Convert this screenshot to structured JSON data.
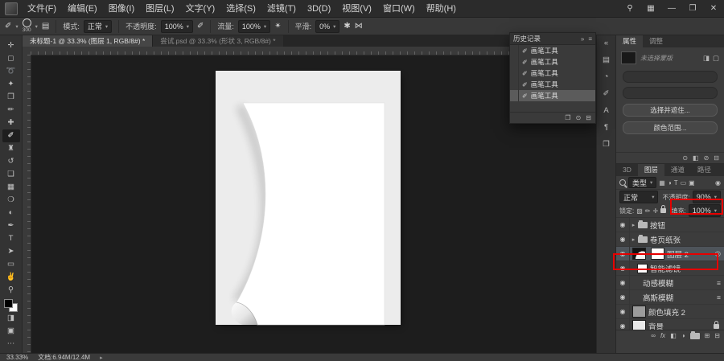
{
  "colors": {
    "accent-red": "#e60000",
    "canvas-bg": "#1d1d1d",
    "panel-bg": "#3c3c3c"
  },
  "menubar": {
    "items": [
      "文件(F)",
      "编辑(E)",
      "图像(I)",
      "图层(L)",
      "文字(Y)",
      "选择(S)",
      "滤镜(T)",
      "3D(D)",
      "视图(V)",
      "窗口(W)",
      "帮助(H)"
    ]
  },
  "optionsbar": {
    "brush_size": "300",
    "mode_label": "模式:",
    "mode_value": "正常",
    "opacity_label": "不透明度:",
    "opacity_value": "100%",
    "flow_label": "流量:",
    "flow_value": "100%",
    "smoothing_label": "平滑:",
    "smoothing_value": "0%"
  },
  "tabs": [
    {
      "title": "未标题-1 @ 33.3% (图层 1, RGB/8#) *"
    },
    {
      "title": "尝试.psd @ 33.3% (形状 3, RGB/8#) *"
    }
  ],
  "history": {
    "title": "历史记录",
    "entries": [
      "画笔工具",
      "画笔工具",
      "画笔工具",
      "画笔工具",
      "画笔工具"
    ],
    "selected_index": 4
  },
  "properties": {
    "tabs": [
      "属性",
      "调整"
    ],
    "mask_note": "未选择蒙版",
    "buttons": [
      "选择并遮住...",
      "颜色范围..."
    ]
  },
  "layers_panel": {
    "tabs": [
      "3D",
      "图层",
      "通道",
      "路径"
    ],
    "filter_value": "类型",
    "blend_mode": "正常",
    "opacity_label": "不透明度:",
    "opacity_value": "90%",
    "lock_label": "锁定:",
    "fill_label": "填充:",
    "fill_value": "100%",
    "layers": [
      {
        "name": "按钮"
      },
      {
        "name": "卷页纸张"
      },
      {
        "name": "图层 2"
      },
      {
        "name": "智能滤镜"
      },
      {
        "name": "动感模糊"
      },
      {
        "name": "高斯模糊"
      },
      {
        "name": "颜色填充 2"
      },
      {
        "name": "背景"
      }
    ]
  },
  "statusbar": {
    "zoom": "33.33%",
    "doc_info": "文档:6.94M/12.4M"
  },
  "icons": {
    "dropdown": "▾",
    "search": "⚲",
    "workspace-switcher": "▦",
    "minimize": "—",
    "restore": "❐",
    "close": "✕",
    "menu": "≡",
    "double-arrow": "»",
    "collapse": "«",
    "eye": "◉",
    "move-tool": "✛",
    "marquee-tool": "◻",
    "lasso-tool": "➰",
    "wand-tool": "✦",
    "crop-tool": "❒",
    "eyedropper-tool": "✏",
    "heal-tool": "✚",
    "brush-tool": "✐",
    "stamp-tool": "♜",
    "history-brush-tool": "↺",
    "eraser-tool": "❑",
    "gradient-tool": "▦",
    "blur-tool": "❍",
    "dodge-tool": "◐",
    "pen-tool": "✒",
    "type-tool": "T",
    "path-tool": "➤",
    "shape-tool": "▭",
    "hand-tool": "✌",
    "zoom-tool": "⚲",
    "quickmask": "◨",
    "screen-mode": "▣",
    "ellipsis": "⋯",
    "toggle-panels": "▤",
    "pressure": "✐",
    "airbrush": "✴",
    "gear": "✱",
    "symmetry": "⋈",
    "swatches": "▤",
    "libraries": "◔",
    "brushes": "✐",
    "character": "A",
    "paragraph": "¶",
    "clone-source": "❐",
    "add-pixel-mask": "◨",
    "add-vector-mask": "▢",
    "load-selection": "⊙",
    "apply-mask": "◧",
    "disable-mask": "⊘",
    "delete": "⊟",
    "filter-pixel": "▦",
    "filter-adjust": "◑",
    "filter-type": "T",
    "filter-shape": "▭",
    "filter-smart": "▣",
    "filter-toggle": "◉",
    "lock-transparent": "▨",
    "lock-pixels": "✏",
    "lock-position": "✛",
    "link": "∞",
    "fx": "fx",
    "adjustment": "◑",
    "new-layer": "⊞",
    "snapshot": "⊙",
    "new-doc-state": "❐",
    "smart-filter-badge": "◎",
    "filter-options": "≡",
    "group-arrow": "▸",
    "status-arrow": "▸",
    "brush-history": "✐"
  }
}
